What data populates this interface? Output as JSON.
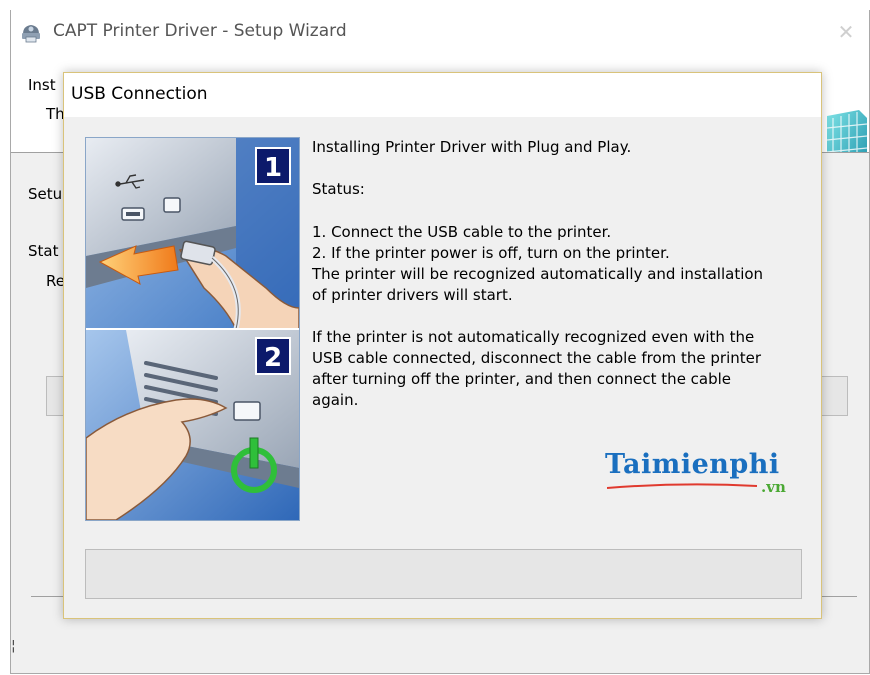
{
  "background_window": {
    "title": "CAPT Printer Driver - Setup Wizard",
    "close_label": "✕",
    "header_title": "Inst",
    "header_sub": "Th",
    "setup_label": "Setu",
    "status_label": "Stat",
    "status_value": "Re",
    "left_mark": "¦",
    "icons": [
      "printer-app-icon",
      "setup-cube-icon",
      "close-icon"
    ],
    "progress_percent": 0
  },
  "dialog": {
    "title": "USB Connection",
    "heading": "Installing Printer Driver with Plug and Play.",
    "status_label": "Status:",
    "step1": "1. Connect the USB cable to the printer.",
    "step2": "2. If the printer power is off, turn on the printer.",
    "info_line1": "The printer will be recognized automatically and installation",
    "info_line2": "of printer drivers will start.",
    "note_line1": "If the printer is not automatically recognized even with the",
    "note_line2": "USB cable connected, disconnect the cable from the printer",
    "note_line3": "after turning off the printer, and then connect the cable",
    "note_line4": "again.",
    "illustration": {
      "panel1_number": "1",
      "panel2_number": "2",
      "panel1_icon": "usb-icon",
      "panel2_icon": "power-icon"
    },
    "progress_percent": 0
  },
  "watermark": {
    "main": "Taimienphi",
    "sub": ".vn"
  },
  "colors": {
    "accent_blue": "#1a6fbf",
    "accent_green": "#4aa833",
    "dialog_border": "#d9c37a",
    "panel_navy": "#0c1a6b"
  }
}
